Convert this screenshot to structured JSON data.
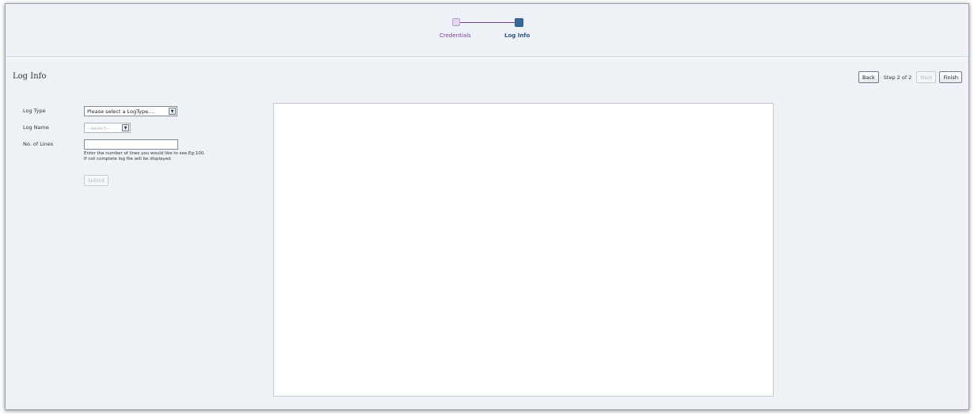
{
  "train": {
    "steps": [
      {
        "label": "Credentials",
        "state": "visited"
      },
      {
        "label": "Log Info",
        "state": "current"
      }
    ]
  },
  "page": {
    "title": "Log Info"
  },
  "nav": {
    "back_label": "Back",
    "step_text": "Step 2 of 2",
    "next_label": "Next",
    "finish_label": "Finish"
  },
  "form": {
    "log_type_label": "Log Type",
    "log_type_value": "Please select a LogType....",
    "log_name_label": "Log Name",
    "log_name_value": "--select--",
    "lines_label": "No. of Lines",
    "lines_value": "",
    "lines_hint_1": "Enter the number of lines you would like to see.Eg:100.",
    "lines_hint_2": "If not complete log file will be displayed",
    "submit_label": "Submit"
  },
  "colors": {
    "visited_step": "#7a3d9a",
    "current_step": "#2c5580",
    "panel_bg": "#eef2f6"
  },
  "icons": {
    "dropdown": "chevron-down-icon"
  }
}
